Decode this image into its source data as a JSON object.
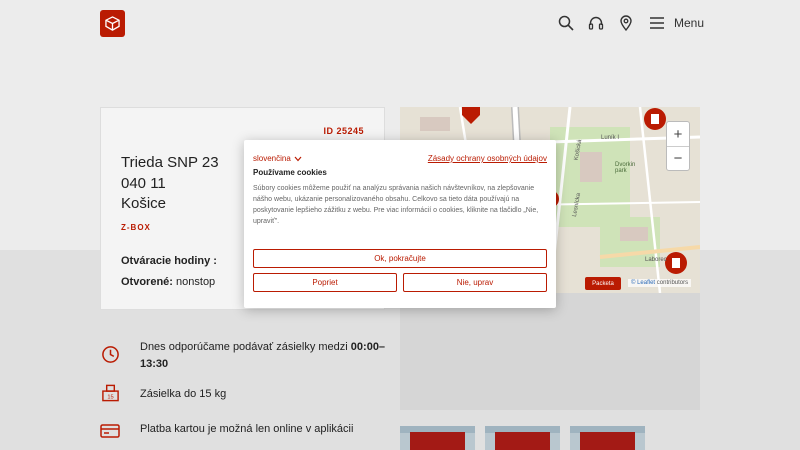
{
  "header": {
    "menu_label": "Menu"
  },
  "card": {
    "id": "ID 25245",
    "street": "Trieda SNP 23",
    "postal_code": "040 11",
    "city": "Košice",
    "type": "Z-BOX",
    "hours_label": "Otváracie hodiny :",
    "open_label": "Otvorené:",
    "open_value": "nonstop"
  },
  "map": {
    "zoom_in": "+",
    "zoom_out": "−",
    "badge": "Packeta",
    "attribution_link": "© Leaflet",
    "attribution_rest": "contributors",
    "street_labels": [
      "Luník I",
      "Košická",
      "Dvorkin park",
      "Lesnícka",
      "Laborec"
    ]
  },
  "features": [
    {
      "text_before": "Dnes odporúčame podávať zásielky medzi ",
      "text_bold": "00:00–13:30"
    },
    {
      "text": "Zásielka do 15 kg"
    },
    {
      "text": "Platba kartou je možná len online v aplikácii"
    }
  ],
  "cookie_dialog": {
    "language": "slovenčina",
    "privacy_link": "Zásady ochrany osobných údajov",
    "title": "Používame cookies",
    "body": "Súbory cookies môžeme použiť na analýzu správania našich návštevníkov, na zlepšovanie nášho webu, ukázanie personalizovaného obsahu. Celkovo sa tieto dáta používajú na poskytovanie lepšieho zážitku z webu. Pre viac informácií o cookies, kliknite na tlačidlo „Nie, upraviť\".",
    "accept_label": "Ok, pokračujte",
    "reject_label": "Popriet",
    "customize_label": "Nie, uprav"
  },
  "colors": {
    "accent": "#ba1b02",
    "background": "#e4e4e4"
  }
}
